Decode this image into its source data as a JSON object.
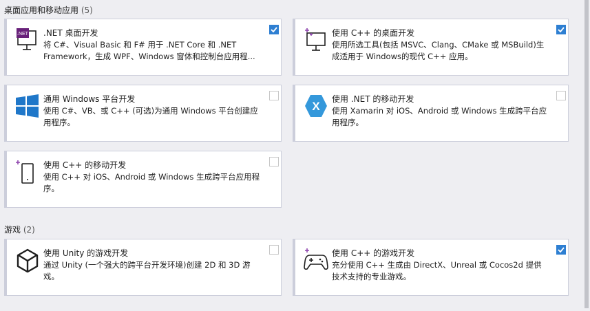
{
  "sections": [
    {
      "title": "桌面应用和移动应用",
      "count": "(5)"
    },
    {
      "title": "游戏",
      "count": "(2)"
    }
  ],
  "cards": [
    {
      "title": ".NET 桌面开发",
      "desc": "将 C#、Visual Basic 和 F# 用于 .NET Core 和 .NET Framework，生成 WPF、Windows 窗体和控制台应用程...",
      "checked": true,
      "icon": "dotnet-desktop-icon",
      "icon_text": ".NET"
    },
    {
      "title": "使用 C++ 的桌面开发",
      "desc": "使用所选工具(包括 MSVC、Clang、CMake 或 MSBuild)生成适用于 Windows的现代 C++ 应用。",
      "checked": true,
      "icon": "cpp-desktop-icon"
    },
    {
      "title": "通用 Windows 平台开发",
      "desc": "使用 C#、VB、或 C++ (可选)为通用 Windows 平台创建应用程序。",
      "checked": false,
      "icon": "windows-logo-icon"
    },
    {
      "title": "使用 .NET 的移动开发",
      "desc": "使用 Xamarin 对 iOS、Android 或 Windows 生成跨平台应用程序。",
      "checked": false,
      "icon": "xamarin-icon",
      "icon_text": "X"
    },
    {
      "title": "使用 C++ 的移动开发",
      "desc": "使用 C++ 对 iOS、Android 或 Windows 生成跨平台应用程序。",
      "checked": false,
      "icon": "cpp-mobile-icon"
    },
    {
      "title": "使用 Unity 的游戏开发",
      "desc": "通过 Unity (一个强大的跨平台开发环境)创建 2D 和 3D 游戏。",
      "checked": false,
      "icon": "unity-icon"
    },
    {
      "title": "使用 C++ 的游戏开发",
      "desc": "充分使用 C++ 生成由 DirectX、Unreal 或 Cocos2d 提供技术支持的专业游戏。",
      "checked": true,
      "icon": "gamepad-icon"
    }
  ],
  "colors": {
    "accent": "#2e7fd2",
    "windows_blue": "#1f77c9",
    "xamarin_blue": "#3498db",
    "cpp_purple": "#8e44ad"
  }
}
